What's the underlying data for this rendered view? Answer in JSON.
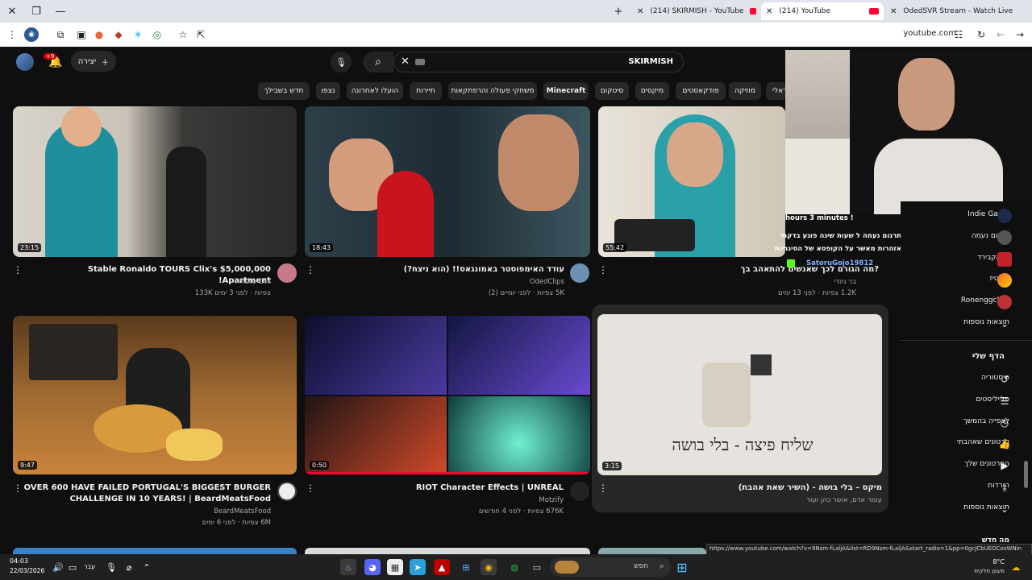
{
  "browser": {
    "tabs": [
      {
        "title": "(214) SKIRMISH - YouTube",
        "active": false
      },
      {
        "title": "(214) YouTube",
        "active": true
      },
      {
        "title": "OdedSVR Stream - Watch Live",
        "active": false
      }
    ],
    "url": "youtube.com",
    "status_url": "https://www.youtube.com/watch?v=9Nsm-fLaljA&list=RD9Nsm-fLaljA&start_radio=1&pp=0gcJCbUEOCosWNin"
  },
  "header": {
    "search_value": "SKIRMISH",
    "create_label": "יצירה",
    "notification_count": "+9"
  },
  "chips": [
    "חדש בשבילך",
    "נצפו",
    "הועלו לאחרונה",
    "תיירות",
    "משחקי פעולה והרפתקאות",
    "Minecraft",
    "סיטקום",
    "מיקסים",
    "פודקאסטים",
    "מוזיקה",
    "ראפ ישראלי"
  ],
  "videos": [
    {
      "title": "Stable Ronaldo TOURS Clix's $5,000,000 Apartment!",
      "channel": "More Clix",
      "meta": "133K צפיות · לפני 3 ימים",
      "duration": "23:15"
    },
    {
      "title": "עודד האימפוסטר באמונגאס!! (הוא ניצח?)",
      "channel": "OdedClips",
      "meta": "5K צפיות · לפני יומיים (2)",
      "duration": "18:43"
    },
    {
      "title": "?מה הגורם לכך שאנשים להתאהב בך",
      "channel": "בר גינדי",
      "meta": "1.2K צפיות · לפני 13 ימים",
      "duration": "55:42"
    },
    {
      "title1": "OVER 600 HAVE FAILED PORTUGAL'S BIGGEST BURGER",
      "title2": "CHALLENGE IN 10 YEARS! | BeardMeatsFood",
      "channel": "BeardMeatsFood",
      "meta": "6M צפיות · לפני 6 ימים",
      "duration": "9:47"
    },
    {
      "title": "RIOT Character Effects | UNREAL",
      "channel": "Motzify",
      "meta": "676K צפיות · לפני 4 חודשים",
      "duration": "0:50"
    },
    {
      "title": "מיקס – בלי בושה - (השיר שאת אהבת)",
      "channel": "עומר אדם, אושר כהן ועוד",
      "duration": "3:15",
      "thumb_caption": "שליח פיצה - בלי בושה"
    }
  ],
  "sidebar": {
    "subs": [
      "Indie Game",
      "תרגום נעמה",
      "בלאקבירד",
      "סולטיז",
      "Ronenggclips"
    ],
    "more_1": "תוצאות נוספות",
    "you_title": "הדף שלי",
    "you_items": [
      "היסטוריה",
      "פלייליסטים",
      "לצפייה בהמשך",
      "סרטונים שאהבתי",
      "הסרטונים שלך",
      "הורדות"
    ],
    "more_2": "תוצאות נוספות",
    "bottom": "מה חדש"
  },
  "chat": {
    "line1": "hours 3 minutes !",
    "line2": "תרגום נעמה ל שעות שינה פוגע בדקתי",
    "line3": "אזהרות מאשר על הקופסא של הסיגריות",
    "line4": "SatoruGojo19812"
  },
  "taskbar": {
    "time": "04:03",
    "date": "22/03/2026",
    "search": "חפש",
    "weather": "8°C",
    "weather_desc": "מעונן חלקית",
    "lang": "עבר"
  }
}
